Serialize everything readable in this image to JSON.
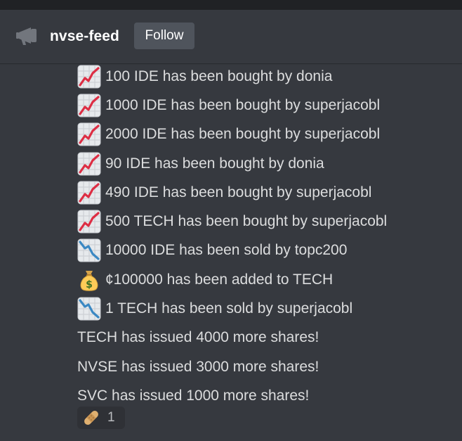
{
  "header": {
    "icon": "announcement-megaphone-icon",
    "channel_name": "nvse-feed",
    "follow_label": "Follow"
  },
  "messages": [
    {
      "icon": "chart-increasing-icon",
      "text": "100 IDE has been bought by donia"
    },
    {
      "icon": "chart-increasing-icon",
      "text": "1000 IDE has been bought by superjacobl"
    },
    {
      "icon": "chart-increasing-icon",
      "text": "2000 IDE has been bought by superjacobl"
    },
    {
      "icon": "chart-increasing-icon",
      "text": "90 IDE has been bought by donia"
    },
    {
      "icon": "chart-increasing-icon",
      "text": "490 IDE has been bought by superjacobl"
    },
    {
      "icon": "chart-increasing-icon",
      "text": "500 TECH has been bought by superjacobl"
    },
    {
      "icon": "chart-decreasing-icon",
      "text": "10000 IDE has been sold by topc200"
    },
    {
      "icon": "money-bag-icon",
      "text": "¢100000 has been added to TECH"
    },
    {
      "icon": "chart-decreasing-icon",
      "text": "1 TECH has been sold by superjacobl"
    },
    {
      "icon": "",
      "text": "TECH has issued 4000 more shares!"
    },
    {
      "icon": "",
      "text": "NVSE has issued 3000 more shares!"
    },
    {
      "icon": "",
      "text": "SVC has issued 1000 more shares!"
    }
  ],
  "reaction": {
    "icon": "bandage-icon",
    "count": "1"
  },
  "colors": {
    "background": "#36393f",
    "top_strip": "#202225",
    "button": "#4f545c",
    "text": "#dcddde",
    "reaction_bg": "#2f3136"
  }
}
